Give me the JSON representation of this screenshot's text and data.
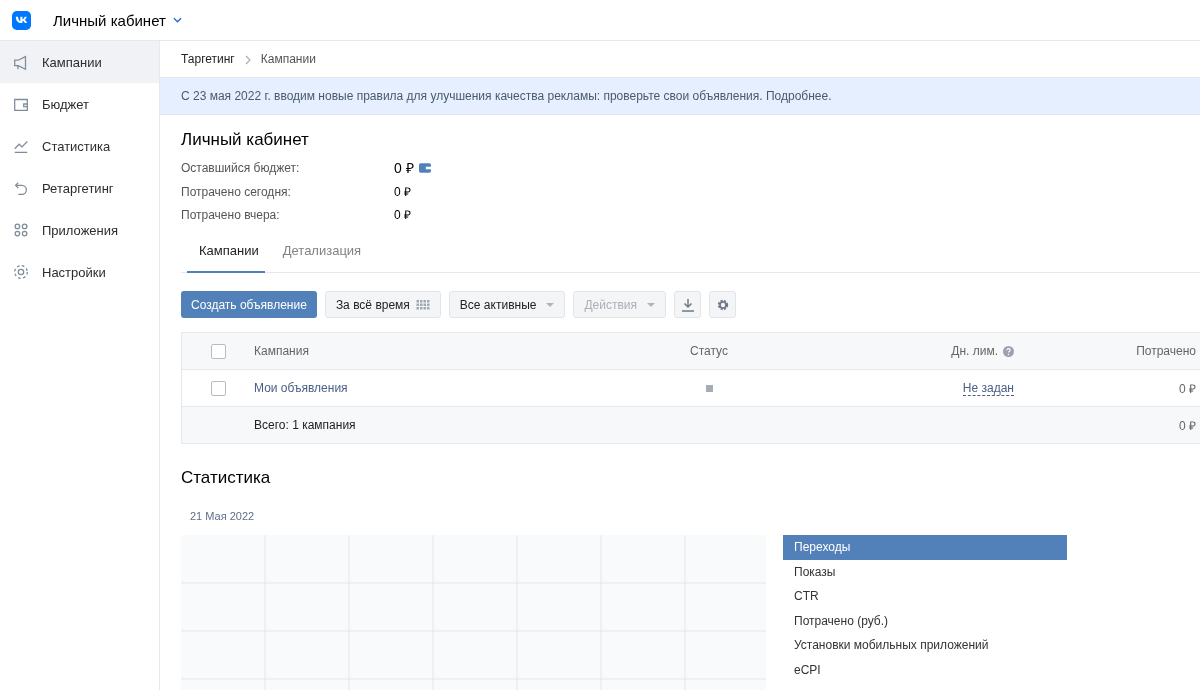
{
  "header": {
    "title": "Личный кабинет"
  },
  "sidebar": {
    "items": [
      {
        "label": "Кампании",
        "selected": true
      },
      {
        "label": "Бюджет",
        "selected": false
      },
      {
        "label": "Статистика",
        "selected": false
      },
      {
        "label": "Ретаргетинг",
        "selected": false
      },
      {
        "label": "Приложения",
        "selected": false
      },
      {
        "label": "Настройки",
        "selected": false
      }
    ]
  },
  "breadcrumbs": [
    "Таргетинг",
    "Кампании"
  ],
  "banner": "С 23 мая 2022 г. вводим новые правила для улучшения качества рекламы: проверьте свои объявления. Подробнее.",
  "account": {
    "title": "Личный кабинет",
    "rows": [
      {
        "label": "Оставшийся бюджет:",
        "value": "0 ₽"
      },
      {
        "label": "Потрачено сегодня:",
        "value": "0 ₽"
      },
      {
        "label": "Потрачено вчера:",
        "value": "0 ₽"
      }
    ]
  },
  "tabs": [
    {
      "label": "Кампании",
      "selected": true
    },
    {
      "label": "Детализация",
      "selected": false
    }
  ],
  "toolbar": {
    "create": "Создать объявление",
    "period": "За всё время",
    "filter": "Все активные",
    "actions": "Действия",
    "actions_disabled": true
  },
  "table": {
    "columns": [
      "Кампания",
      "Статус",
      "Дн. лим.",
      "Потрачено"
    ],
    "header_checked": false,
    "rows": [
      {
        "checked": false,
        "name": "Мои объявления",
        "limit": "Не задан",
        "spent": "0 ₽"
      }
    ],
    "total": {
      "label": "Всего: 1 кампания",
      "spent": "0 ₽"
    }
  },
  "stats": {
    "title": "Статистика",
    "date": "21 Мая 2022",
    "metrics": [
      {
        "label": "Переходы",
        "selected": true
      },
      {
        "label": "Показы",
        "selected": false
      },
      {
        "label": "CTR",
        "selected": false
      },
      {
        "label": "Потрачено (руб.)",
        "selected": false
      },
      {
        "label": "Установки мобильных приложений",
        "selected": false
      },
      {
        "label": "eCPI",
        "selected": false
      }
    ]
  }
}
